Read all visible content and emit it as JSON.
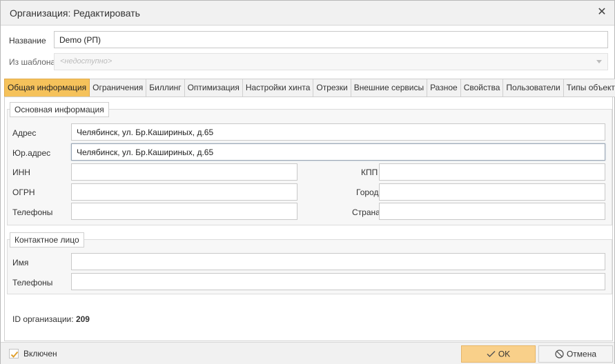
{
  "window": {
    "title": "Организация: Редактировать"
  },
  "header": {
    "name_label": "Название",
    "name_value": "Demo (РП)",
    "template_label": "Из шаблона",
    "template_placeholder": "<недоступно>"
  },
  "tabs": [
    {
      "label": "Общая информация"
    },
    {
      "label": "Ограничения"
    },
    {
      "label": "Биллинг"
    },
    {
      "label": "Оптимизация"
    },
    {
      "label": "Настройки хинта"
    },
    {
      "label": "Отрезки"
    },
    {
      "label": "Внешние сервисы"
    },
    {
      "label": "Разное"
    },
    {
      "label": "Свойства"
    },
    {
      "label": "Пользователи"
    },
    {
      "label": "Типы объектов"
    }
  ],
  "basic": {
    "legend": "Основная информация",
    "address_label": "Адрес",
    "address_value": "Челябинск, ул. Бр.Кашириных, д.65",
    "legal_address_label": "Юр.адрес",
    "legal_address_value": "Челябинск, ул. Бр.Кашириных, д.65",
    "inn_label": "ИНН",
    "inn_value": "",
    "kpp_label": "КПП",
    "kpp_value": "",
    "ogrn_label": "ОГРН",
    "ogrn_value": "",
    "city_label": "Город",
    "city_value": "",
    "phones_label": "Телефоны",
    "phones_value": "",
    "country_label": "Страна",
    "country_value": ""
  },
  "contact": {
    "legend": "Контактное лицо",
    "name_label": "Имя",
    "name_value": "",
    "phones_label": "Телефоны",
    "phones_value": ""
  },
  "org_id": {
    "label": "ID организации:",
    "value": "209"
  },
  "footer": {
    "enabled_label": "Включен",
    "ok_label": "OK",
    "cancel_label": "Отмена"
  },
  "colors": {
    "active_tab": "#f5c25b",
    "ok_button": "#f9d08a",
    "check": "#e0a02e"
  }
}
